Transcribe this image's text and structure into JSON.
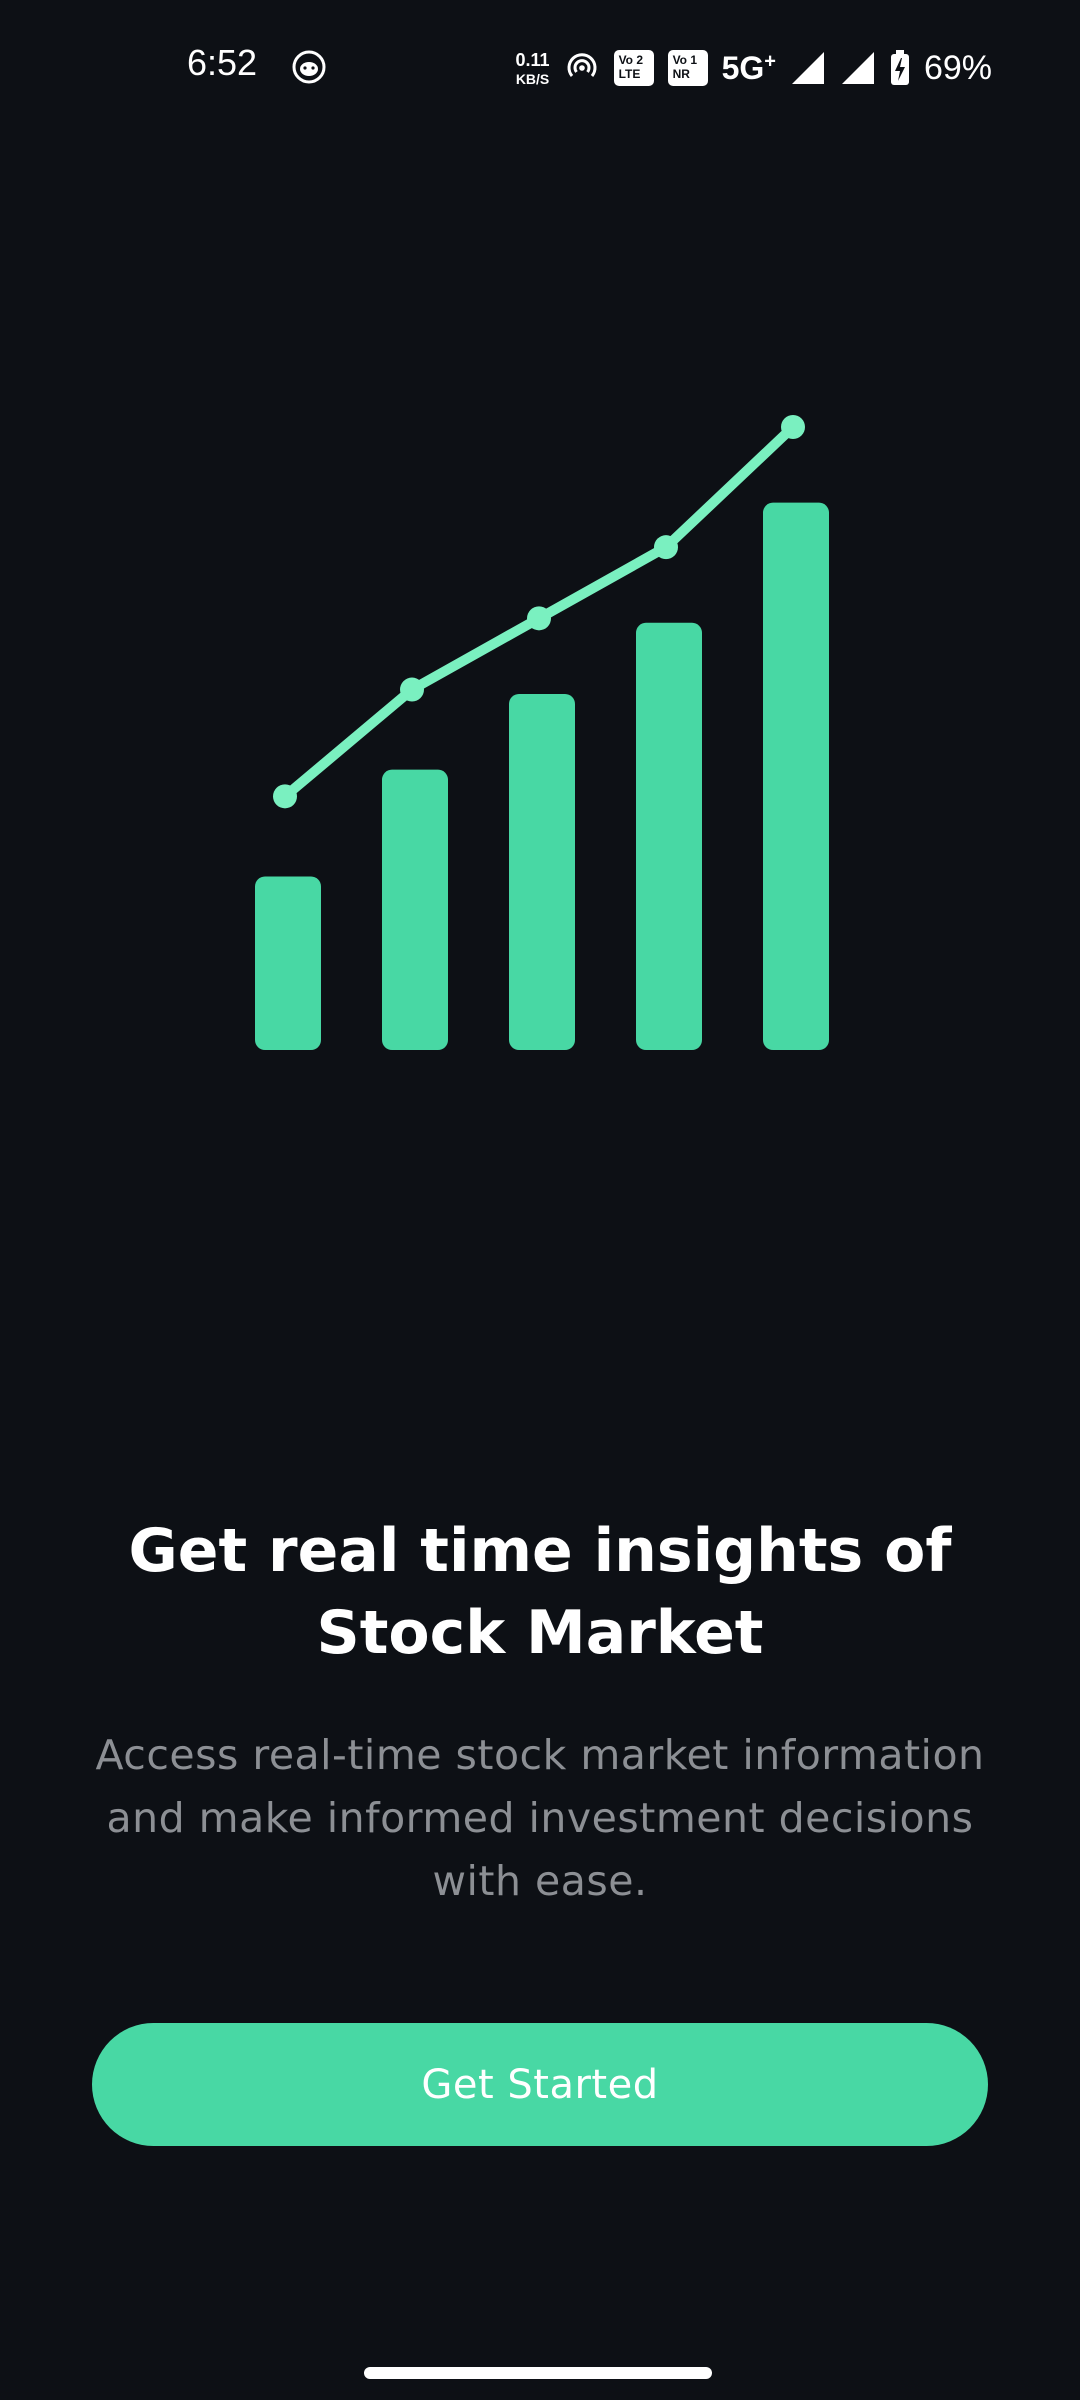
{
  "status_bar": {
    "time": "6:52",
    "net_speed_value": "0.11",
    "net_speed_unit": "KB/S",
    "sim1_top": "Vo 2",
    "sim1_bottom": "LTE",
    "sim2_top": "Vo 1",
    "sim2_bottom": "NR",
    "network": "5G",
    "network_plus": "+",
    "battery": "69%",
    "icons": [
      "cat-face-icon",
      "hotspot-icon",
      "signal-icon",
      "signal-icon",
      "battery-charging-icon"
    ]
  },
  "illustration": {
    "bar_values": [
      39,
      63,
      80,
      96,
      123
    ],
    "line_values": [
      57,
      81,
      97,
      113,
      140
    ],
    "bar_color": "#48d8a4",
    "line_color": "#7af0c0"
  },
  "onboarding": {
    "title_line1": "Get real time insights of",
    "title_line2": "Stock Market",
    "subtitle_line1": "Access real-time stock market information",
    "subtitle_line2": "and make informed investment decisions",
    "subtitle_line3": "with ease.",
    "cta_label": "Get Started"
  },
  "colors": {
    "background": "#0d1015",
    "accent": "#48d8a4",
    "title": "#ffffff",
    "subtitle": "#8c8f94"
  }
}
